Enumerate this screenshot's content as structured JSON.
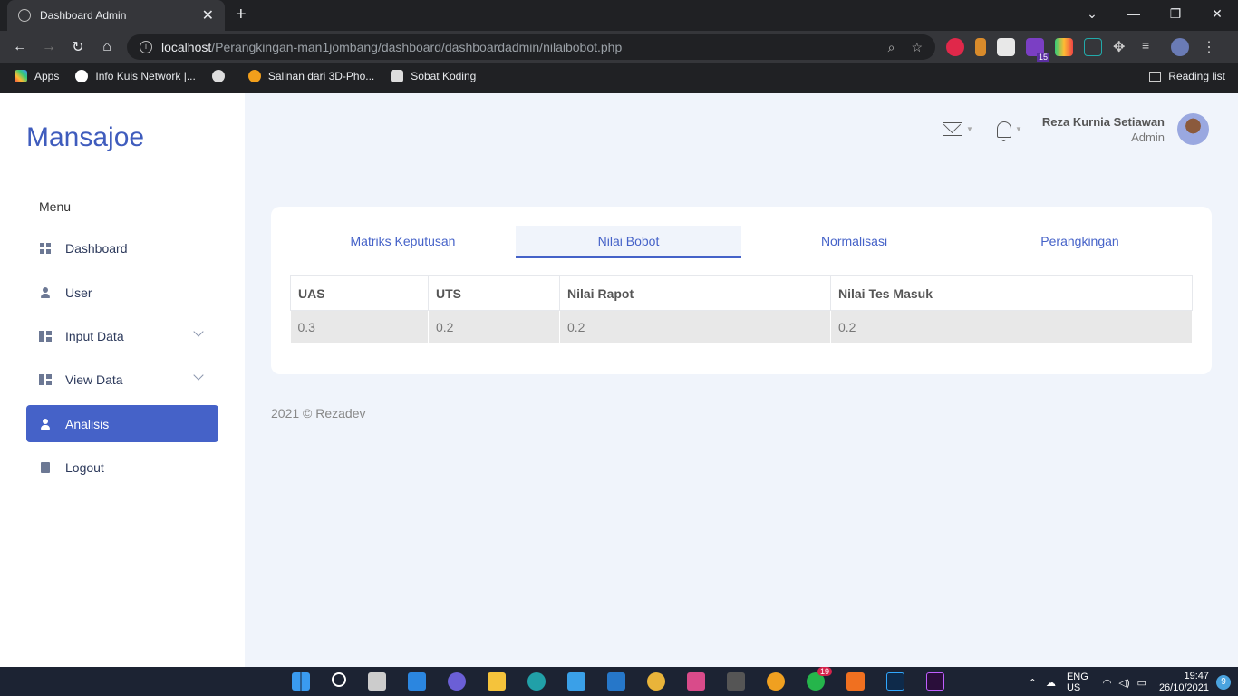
{
  "browser": {
    "tab_title": "Dashboard Admin",
    "url_host": "localhost",
    "url_path": "/Perangkingan-man1jombang/dashboard/dashboardadmin/nilaibobot.php",
    "bookmarks": [
      "Apps",
      "Info Kuis Network |...",
      "Salinan dari 3D-Pho...",
      "Sobat Koding"
    ],
    "reading_list": "Reading list"
  },
  "sidebar": {
    "brand": "Mansajoe",
    "menu_label": "Menu",
    "items": [
      {
        "label": "Dashboard",
        "icon": "grid-icon"
      },
      {
        "label": "User",
        "icon": "user-icon"
      },
      {
        "label": "Input Data",
        "icon": "dashboard-icon"
      },
      {
        "label": "View Data",
        "icon": "dashboard-icon"
      },
      {
        "label": "Analisis",
        "icon": "user-icon"
      },
      {
        "label": "Logout",
        "icon": "document-icon"
      }
    ]
  },
  "header": {
    "user_name": "Reza Kurnia Setiawan",
    "user_role": "Admin"
  },
  "main": {
    "tabs": [
      "Matriks Keputusan",
      "Nilai Bobot",
      "Normalisasi",
      "Perangkingan"
    ],
    "active_tab": "Nilai Bobot",
    "table": {
      "headers": [
        "UAS",
        "UTS",
        "Nilai Rapot",
        "Nilai Tes Masuk"
      ],
      "rows": [
        [
          "0.3",
          "0.2",
          "0.2",
          "0.2"
        ]
      ]
    }
  },
  "footer": "2021 © Rezadev",
  "taskbar": {
    "lang_top": "ENG",
    "lang_bottom": "US",
    "time": "19:47",
    "date": "26/10/2021",
    "whatsapp_badge": "19",
    "notifications": "9",
    "ext_badge": "15"
  },
  "colors": {
    "accent": "#4562c8",
    "brand": "#3f5cbd",
    "background": "#f0f4fb"
  }
}
